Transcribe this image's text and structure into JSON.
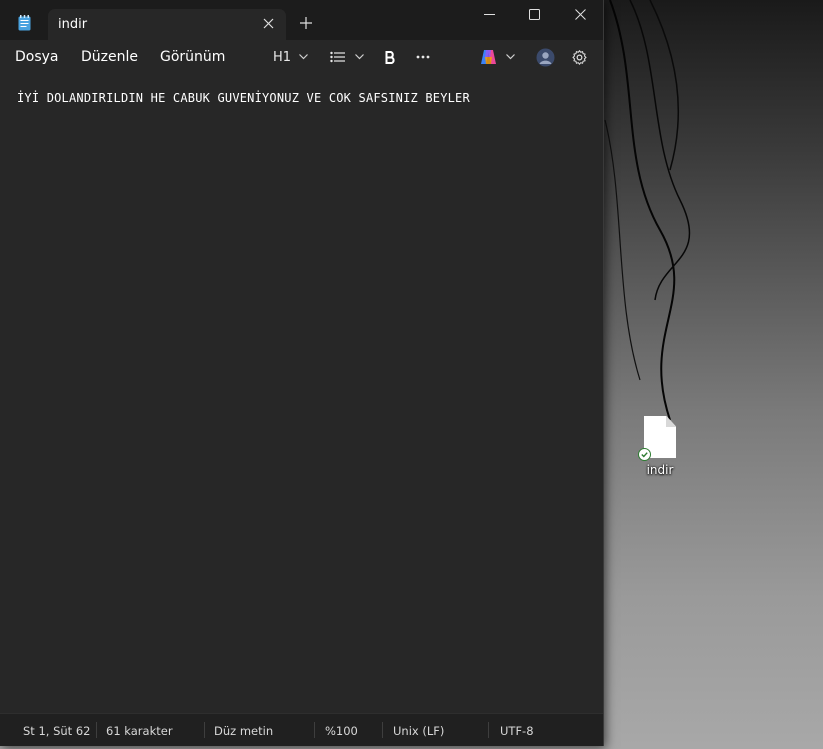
{
  "window": {
    "tab_title": "indir"
  },
  "menu": {
    "items": [
      "Dosya",
      "Düzenle",
      "Görünüm"
    ]
  },
  "toolbar": {
    "heading_label": "H1",
    "icons": [
      "list-icon",
      "bold-icon",
      "more-icon",
      "copilot-icon",
      "profile-icon",
      "gear-icon"
    ]
  },
  "editor": {
    "content": "İYİ DOLANDIRILDIN HE CABUK GUVENİYONUZ VE COK SAFSINIZ BEYLER"
  },
  "status": {
    "position": "St 1, Süt 62",
    "characters": "61 karakter",
    "format": "Düz metin",
    "zoom": "%100",
    "line_ending": "Unix (LF)",
    "encoding": "UTF-8"
  },
  "desktop": {
    "file_label": "indir"
  },
  "colors": {
    "window_bg": "#202020",
    "editor_bg": "#272727",
    "text": "#ffffff",
    "accent_icon": "#4aa3e0"
  }
}
